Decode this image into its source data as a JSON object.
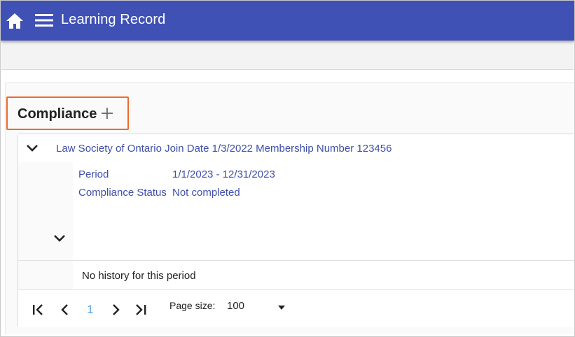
{
  "header": {
    "title": "Learning Record",
    "home_icon": "home-icon",
    "menu_icon": "hamburger-menu-icon",
    "bg_color": "#3f51b5"
  },
  "section": {
    "title": "Compliance",
    "add_icon": "plus-icon",
    "highlight_color": "#ee6a2a"
  },
  "record": {
    "title": "Law Society of Ontario Join Date 1/3/2022 Membership Number 123456",
    "expand_icon": "chevron-down-icon",
    "period_label": "Period",
    "period_value": "1/1/2023 - 12/31/2023",
    "status_label": "Compliance Status",
    "status_value": "Not completed",
    "history_text": "No history for this period",
    "link_color": "#3f4fa8"
  },
  "pager": {
    "first_icon": "first-page-icon",
    "prev_icon": "previous-page-icon",
    "current_page": "1",
    "next_icon": "next-page-icon",
    "last_icon": "last-page-icon",
    "page_size_label": "Page size:",
    "page_size_value": "100"
  }
}
